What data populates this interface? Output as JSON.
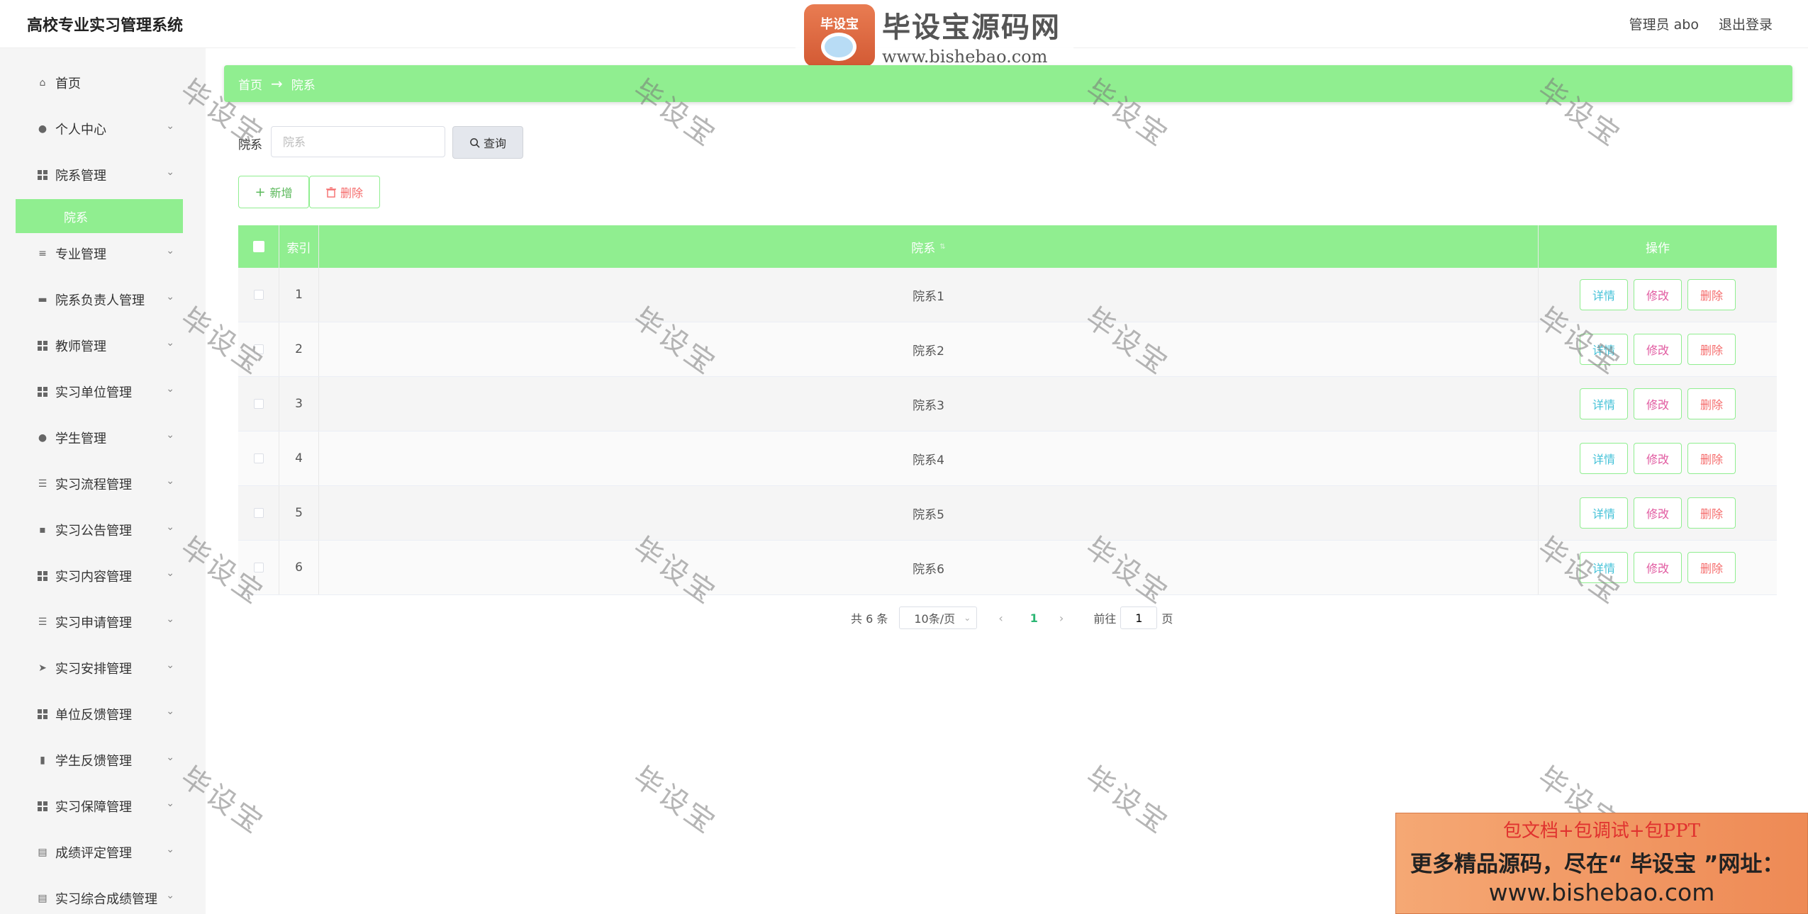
{
  "app": {
    "title": "高校专业实习管理系统",
    "user_label": "管理员 abo",
    "logout_label": "退出登录"
  },
  "watermark": {
    "badge_text": "毕设宝",
    "brand": "毕设宝源码网",
    "url": "www.bishebao.com",
    "tile_text": "毕设宝"
  },
  "sidebar": {
    "items": [
      {
        "label": "首页",
        "icon": "home-icon"
      },
      {
        "label": "个人中心",
        "icon": "user-icon"
      },
      {
        "label": "院系管理",
        "icon": "grid-icon"
      },
      {
        "label": "专业管理",
        "icon": "sliders-icon"
      },
      {
        "label": "院系负责人管理",
        "icon": "printer-icon"
      },
      {
        "label": "教师管理",
        "icon": "grid-icon"
      },
      {
        "label": "实习单位管理",
        "icon": "grid-icon"
      },
      {
        "label": "学生管理",
        "icon": "user-icon"
      },
      {
        "label": "实习流程管理",
        "icon": "list-icon"
      },
      {
        "label": "实习公告管理",
        "icon": "chat-icon"
      },
      {
        "label": "实习内容管理",
        "icon": "grid-icon"
      },
      {
        "label": "实习申请管理",
        "icon": "list-icon"
      },
      {
        "label": "实习安排管理",
        "icon": "send-icon"
      },
      {
        "label": "单位反馈管理",
        "icon": "grid-icon"
      },
      {
        "label": "学生反馈管理",
        "icon": "bar-chart-icon"
      },
      {
        "label": "实习保障管理",
        "icon": "grid-icon"
      },
      {
        "label": "成绩评定管理",
        "icon": "clipboard-icon"
      },
      {
        "label": "实习综合成绩管理",
        "icon": "clipboard-icon"
      }
    ],
    "active_sub": "院系"
  },
  "breadcrumb": {
    "home": "首页",
    "current": "院系"
  },
  "search": {
    "label": "院系",
    "placeholder": "院系",
    "button": "查询"
  },
  "actions": {
    "add": "新增",
    "delete": "删除"
  },
  "table": {
    "headers": {
      "index": "索引",
      "name": "院系",
      "ops": "操作"
    },
    "rows": [
      {
        "index": "1",
        "name": "院系1"
      },
      {
        "index": "2",
        "name": "院系2"
      },
      {
        "index": "3",
        "name": "院系3"
      },
      {
        "index": "4",
        "name": "院系4"
      },
      {
        "index": "5",
        "name": "院系5"
      },
      {
        "index": "6",
        "name": "院系6"
      }
    ],
    "op_detail": "详情",
    "op_edit": "修改",
    "op_delete": "删除"
  },
  "pagination": {
    "total": "共 6 条",
    "page_size": "10条/页",
    "current_page": "1",
    "goto_prefix": "前往",
    "goto_value": "1",
    "goto_suffix": "页"
  },
  "ad": {
    "line1": "包文档+包调试+包PPT",
    "line2": "更多精品源码，尽在“ 毕设宝 ”网址：",
    "line3": "www.bishebao.com"
  },
  "colors": {
    "accent": "#90ee90",
    "sidebar_bg": "#f5f5f5",
    "danger": "#f56c6c"
  }
}
